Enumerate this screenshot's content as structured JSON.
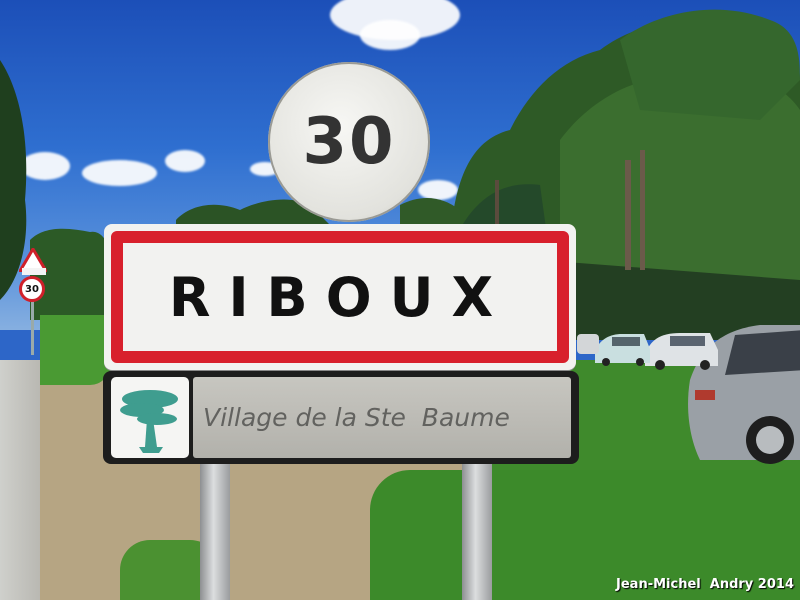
{
  "photo": {
    "description_alt": "Village entry sign with speed limit",
    "speed_limit_sign": {
      "value": "30"
    },
    "town_sign": {
      "name": "RIBOUX"
    },
    "sub_sign": {
      "text": "Village de la Ste  Baume"
    },
    "small_speed_sign": {
      "value": "30"
    },
    "credit": "Jean-Michel  Andry 2014"
  },
  "colors": {
    "sky": "#2f6fd0",
    "sign_border_red": "#d8202c",
    "grass": "#3f8a2c",
    "dirt": "#b6a583"
  }
}
